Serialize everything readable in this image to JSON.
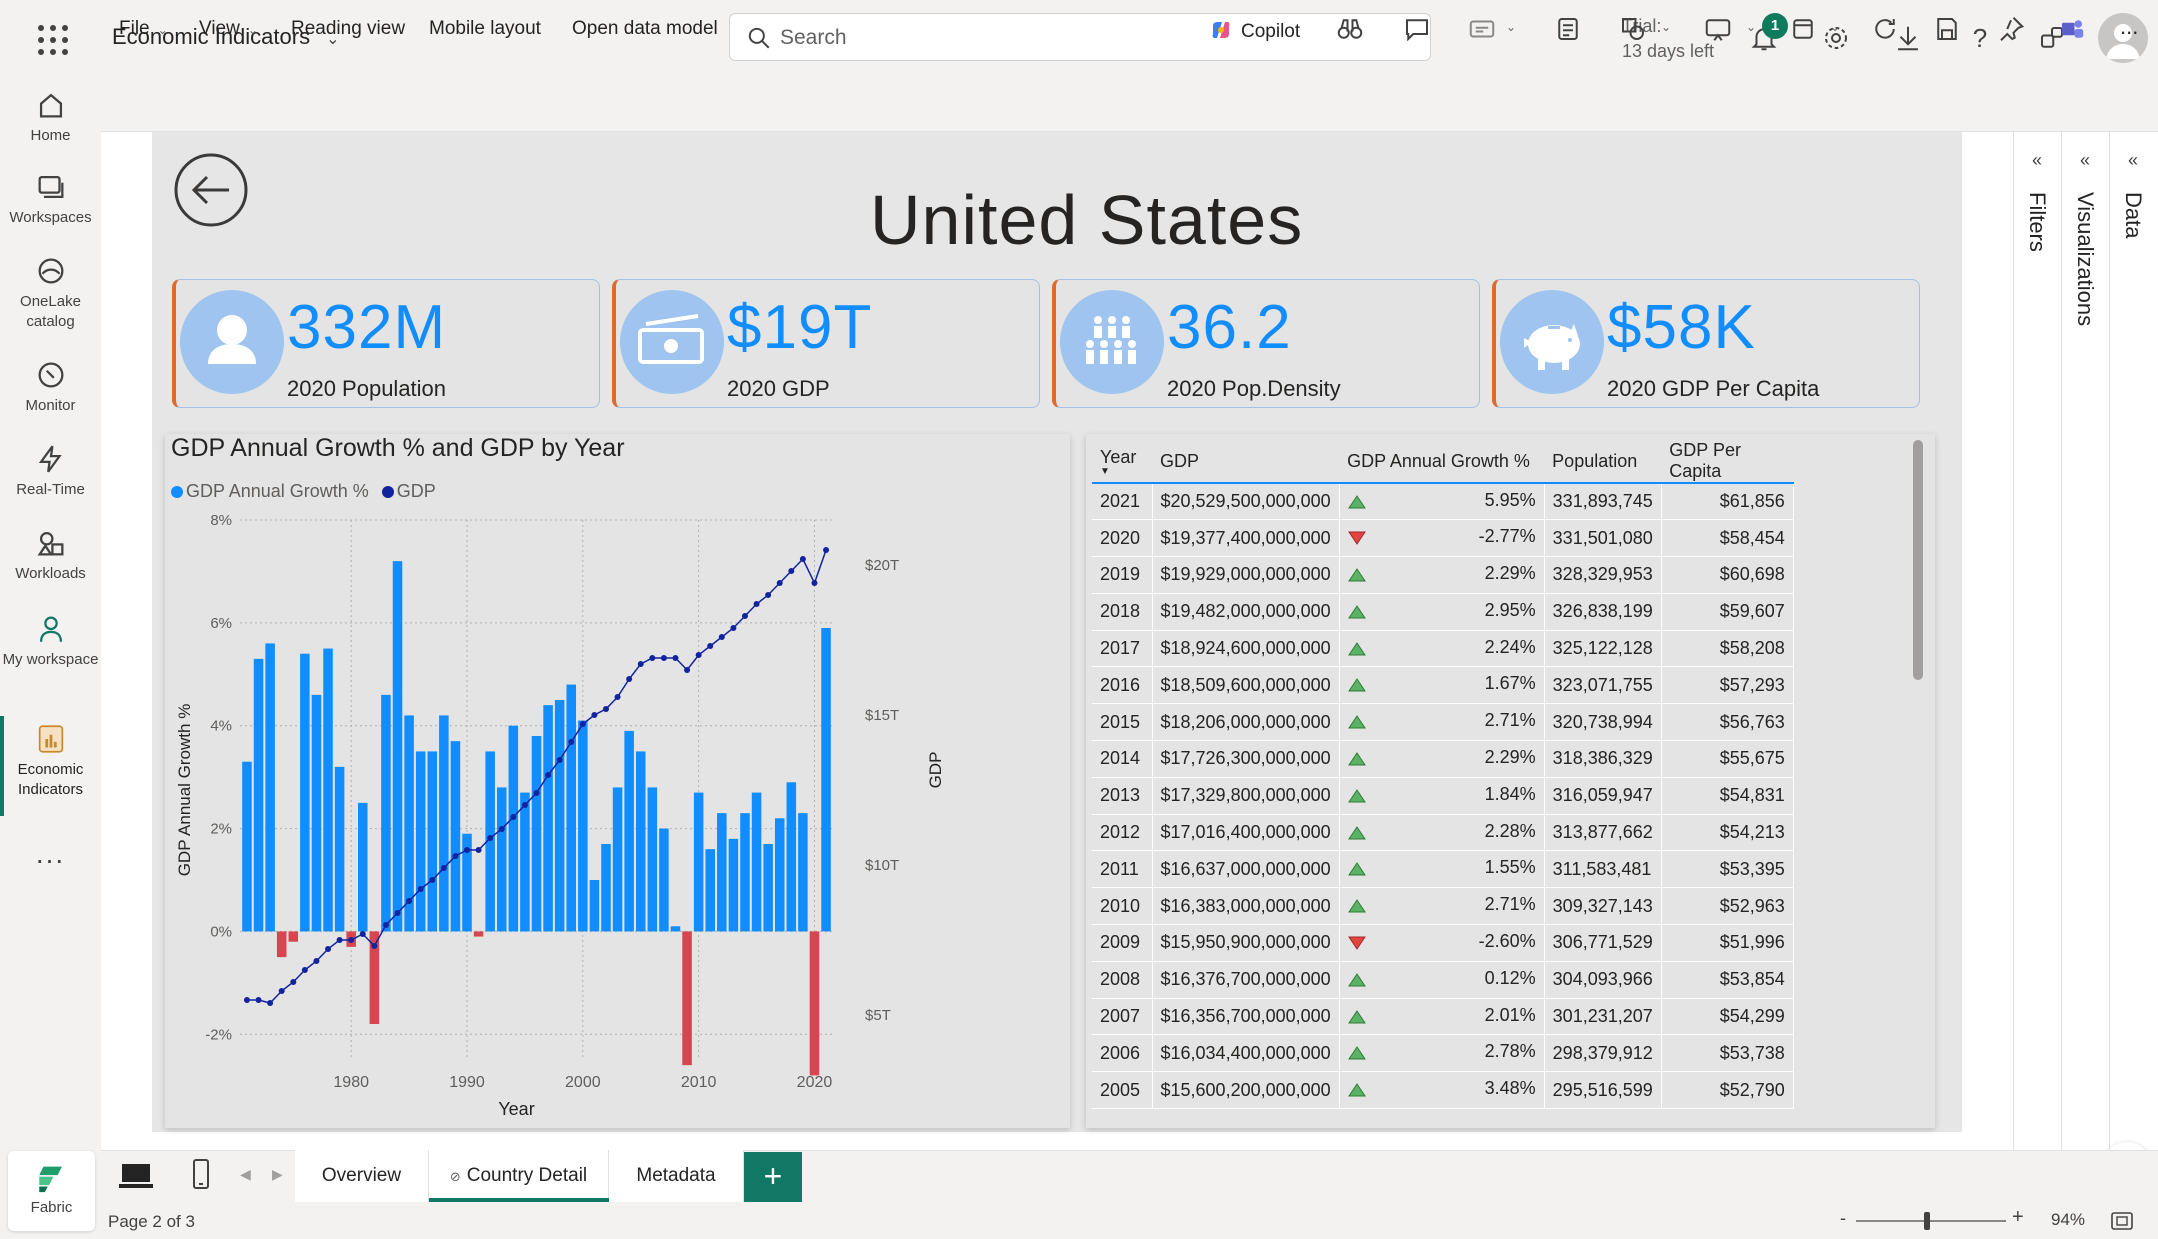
{
  "app": {
    "title": "Economic Indicators"
  },
  "search": {
    "placeholder": "Search"
  },
  "trial": {
    "line1": "Trial:",
    "line2": "13 days left"
  },
  "notifications": {
    "count": "1"
  },
  "rail": {
    "items": [
      {
        "label": "Home",
        "icon": "home-icon"
      },
      {
        "label": "Workspaces",
        "icon": "workspaces-icon"
      },
      {
        "label": "OneLake catalog",
        "icon": "onelake-icon"
      },
      {
        "label": "Monitor",
        "icon": "monitor-icon"
      },
      {
        "label": "Real-Time",
        "icon": "realtime-icon"
      },
      {
        "label": "Workloads",
        "icon": "workloads-icon"
      },
      {
        "label": "My workspace",
        "icon": "my-workspace-icon"
      },
      {
        "label": "Economic Indicators",
        "icon": "report-icon"
      }
    ],
    "more": "...",
    "fabric_label": "Fabric"
  },
  "ribbon": {
    "file": "File",
    "view": "View",
    "reading_view": "Reading view",
    "mobile_layout": "Mobile layout",
    "open_data_model": "Open data model",
    "copilot": "Copilot",
    "more": "..."
  },
  "report": {
    "country": "United States",
    "kpis": [
      {
        "value": "332M",
        "label": "2020 Population",
        "icon": "person-icon"
      },
      {
        "value": "$19T",
        "label": "2020 GDP",
        "icon": "money-icon"
      },
      {
        "value": "36.2",
        "label": "2020 Pop.Density",
        "icon": "crowd-icon"
      },
      {
        "value": "$58K",
        "label": "2020 GDP Per Capita",
        "icon": "piggy-bank-icon"
      }
    ]
  },
  "chart_data": {
    "type": "bar",
    "title": "GDP Annual Growth % and GDP by Year",
    "xlabel": "Year",
    "ylabel": "GDP Annual Growth %",
    "y2label": "GDP",
    "legend": [
      "GDP Annual Growth %",
      "GDP"
    ],
    "legend_position": "top-left",
    "colors": {
      "bars_pos": "#118dff",
      "bars_neg": "#d64550",
      "line": "#12239e"
    },
    "x_ticks": [
      "1980",
      "1990",
      "2000",
      "2010",
      "2020"
    ],
    "y_ticks": [
      "8%",
      "6%",
      "4%",
      "2%",
      "0%",
      "-2%"
    ],
    "y2_ticks": [
      "$20T",
      "$15T",
      "$10T",
      "$5T"
    ],
    "ylim": [
      -2.5,
      8
    ],
    "y2lim": [
      3.5,
      21.5
    ],
    "years": [
      1971,
      1972,
      1973,
      1974,
      1975,
      1976,
      1977,
      1978,
      1979,
      1980,
      1981,
      1982,
      1983,
      1984,
      1985,
      1986,
      1987,
      1988,
      1989,
      1990,
      1991,
      1992,
      1993,
      1994,
      1995,
      1996,
      1997,
      1998,
      1999,
      2000,
      2001,
      2002,
      2003,
      2004,
      2005,
      2006,
      2007,
      2008,
      2009,
      2010,
      2011,
      2012,
      2013,
      2014,
      2015,
      2016,
      2017,
      2018,
      2019,
      2020,
      2021
    ],
    "series": [
      {
        "name": "GDP Annual Growth %",
        "values": [
          3.3,
          5.3,
          5.6,
          -0.5,
          -0.2,
          5.4,
          4.6,
          5.5,
          3.2,
          -0.3,
          2.5,
          -1.8,
          4.6,
          7.2,
          4.2,
          3.5,
          3.5,
          4.2,
          3.7,
          1.9,
          -0.1,
          3.5,
          2.8,
          4.0,
          2.7,
          3.8,
          4.4,
          4.5,
          4.8,
          4.1,
          1.0,
          1.7,
          2.8,
          3.9,
          3.5,
          2.8,
          2.0,
          0.1,
          -2.6,
          2.7,
          1.6,
          2.3,
          1.8,
          2.3,
          2.7,
          1.7,
          2.2,
          2.9,
          2.3,
          -2.8,
          5.9
        ]
      },
      {
        "name": "GDP",
        "values": [
          5.5,
          5.5,
          5.4,
          5.8,
          6.1,
          6.5,
          6.8,
          7.2,
          7.5,
          7.5,
          7.7,
          7.3,
          8.0,
          8.4,
          8.8,
          9.2,
          9.5,
          9.9,
          10.3,
          10.5,
          10.5,
          10.9,
          11.2,
          11.6,
          12.0,
          12.4,
          13.0,
          13.5,
          14.1,
          14.7,
          15.0,
          15.2,
          15.6,
          16.2,
          16.7,
          16.9,
          16.9,
          16.9,
          16.5,
          17.0,
          17.3,
          17.6,
          17.9,
          18.3,
          18.7,
          19.0,
          19.4,
          19.8,
          20.2,
          19.4,
          20.5
        ]
      }
    ]
  },
  "table": {
    "headers": [
      "Year",
      "GDP",
      "GDP Annual Growth %",
      "Population",
      "GDP Per Capita"
    ],
    "rows": [
      [
        "2021",
        "$20,529,500,000,000",
        "up",
        "5.95%",
        "331,893,745",
        "$61,856"
      ],
      [
        "2020",
        "$19,377,400,000,000",
        "down",
        "-2.77%",
        "331,501,080",
        "$58,454"
      ],
      [
        "2019",
        "$19,929,000,000,000",
        "up",
        "2.29%",
        "328,329,953",
        "$60,698"
      ],
      [
        "2018",
        "$19,482,000,000,000",
        "up",
        "2.95%",
        "326,838,199",
        "$59,607"
      ],
      [
        "2017",
        "$18,924,600,000,000",
        "up",
        "2.24%",
        "325,122,128",
        "$58,208"
      ],
      [
        "2016",
        "$18,509,600,000,000",
        "up",
        "1.67%",
        "323,071,755",
        "$57,293"
      ],
      [
        "2015",
        "$18,206,000,000,000",
        "up",
        "2.71%",
        "320,738,994",
        "$56,763"
      ],
      [
        "2014",
        "$17,726,300,000,000",
        "up",
        "2.29%",
        "318,386,329",
        "$55,675"
      ],
      [
        "2013",
        "$17,329,800,000,000",
        "up",
        "1.84%",
        "316,059,947",
        "$54,831"
      ],
      [
        "2012",
        "$17,016,400,000,000",
        "up",
        "2.28%",
        "313,877,662",
        "$54,213"
      ],
      [
        "2011",
        "$16,637,000,000,000",
        "up",
        "1.55%",
        "311,583,481",
        "$53,395"
      ],
      [
        "2010",
        "$16,383,000,000,000",
        "up",
        "2.71%",
        "309,327,143",
        "$52,963"
      ],
      [
        "2009",
        "$15,950,900,000,000",
        "down",
        "-2.60%",
        "306,771,529",
        "$51,996"
      ],
      [
        "2008",
        "$16,376,700,000,000",
        "up",
        "0.12%",
        "304,093,966",
        "$53,854"
      ],
      [
        "2007",
        "$16,356,700,000,000",
        "up",
        "2.01%",
        "301,231,207",
        "$54,299"
      ],
      [
        "2006",
        "$16,034,400,000,000",
        "up",
        "2.78%",
        "298,379,912",
        "$53,738"
      ],
      [
        "2005",
        "$15,600,200,000,000",
        "up",
        "3.48%",
        "295,516,599",
        "$52,790"
      ]
    ]
  },
  "panes": {
    "filters": "Filters",
    "visualizations": "Visualizations",
    "data": "Data"
  },
  "tabs": {
    "items": [
      "Overview",
      "Country Detail",
      "Metadata"
    ],
    "active": "Country Detail",
    "add": "+"
  },
  "status": {
    "page": "Page 2 of 3",
    "zoom": "94%",
    "zoom_level": 0.47
  }
}
